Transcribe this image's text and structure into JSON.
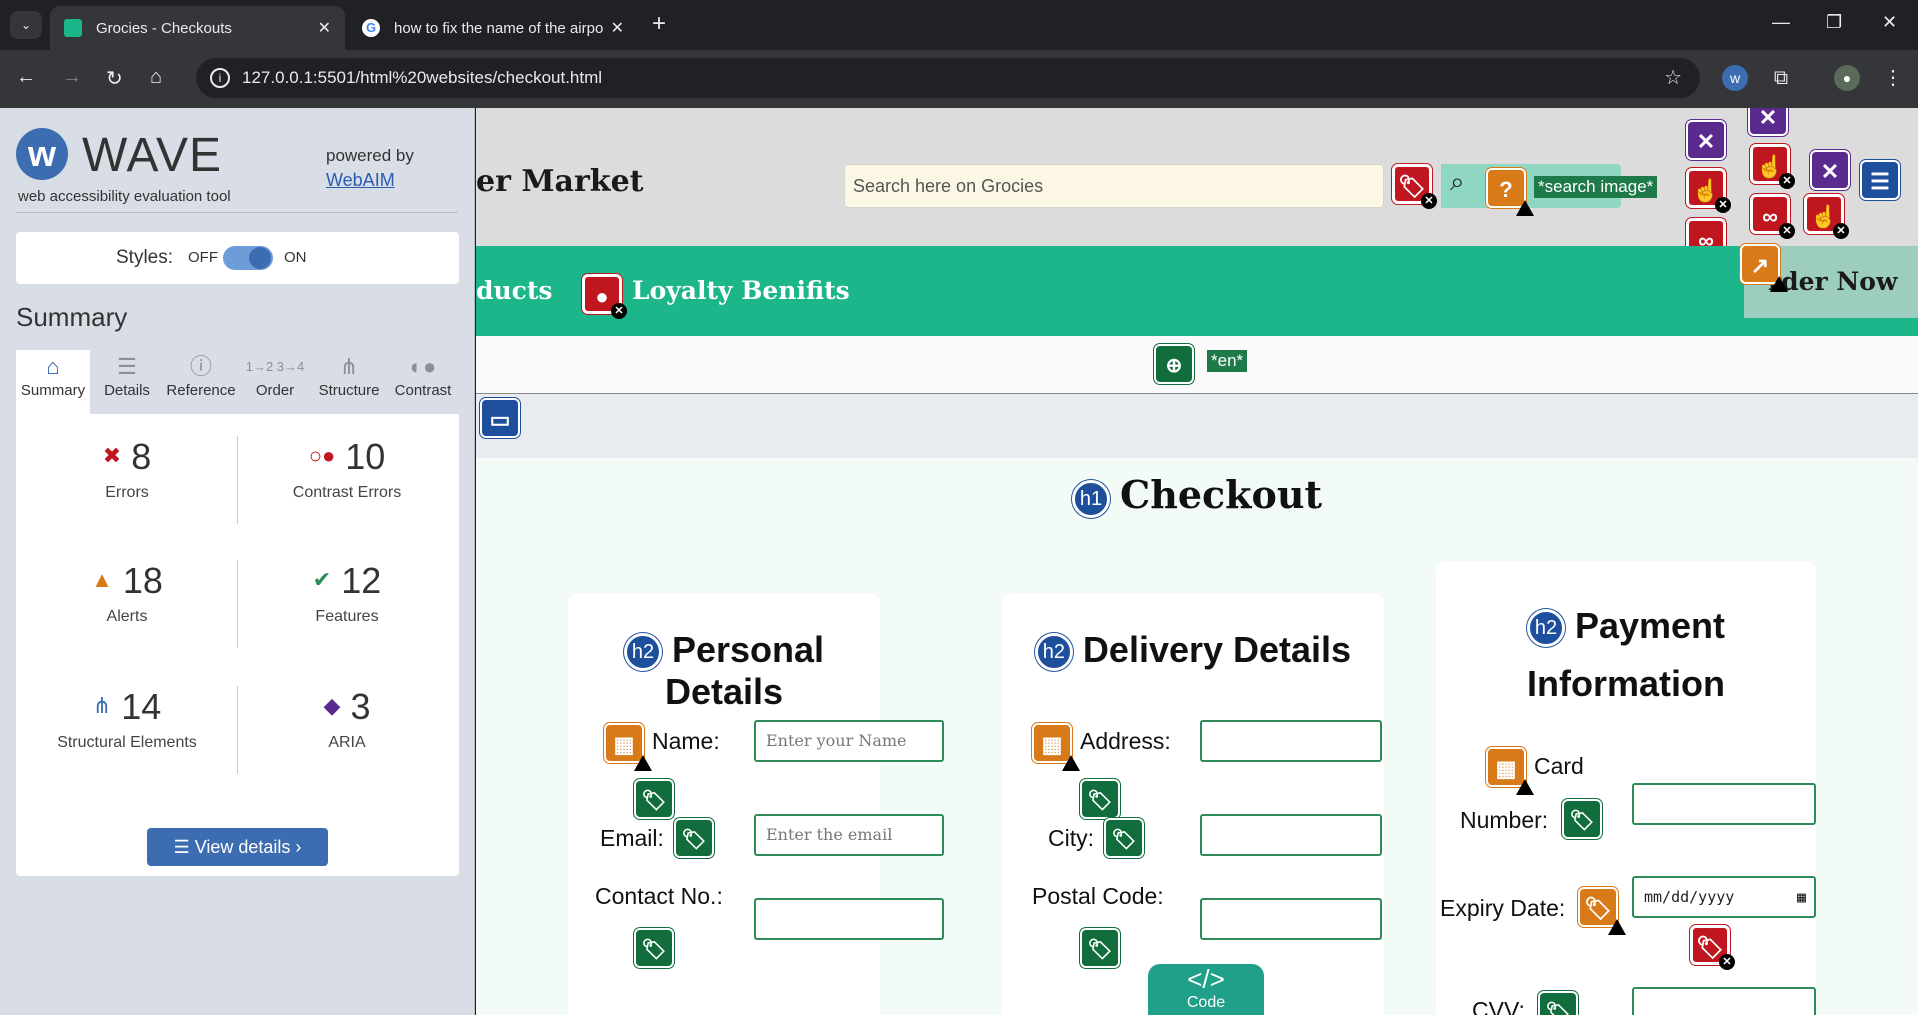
{
  "browser": {
    "tabs": [
      {
        "title": "Grocies - Checkouts",
        "active": true
      },
      {
        "title": "how to fix the name of the airpo",
        "active": false
      }
    ],
    "url": "127.0.0.1:5501/html%20websites/checkout.html"
  },
  "wave": {
    "name": "WAVE",
    "subtitle": "web accessibility evaluation tool",
    "powered_by": "powered by",
    "webaim": "WebAIM",
    "styles_label": "Styles:",
    "styles_off": "OFF",
    "styles_on": "ON",
    "summary_title": "Summary",
    "tabs": [
      "Summary",
      "Details",
      "Reference",
      "Order",
      "Structure",
      "Contrast"
    ],
    "stats": {
      "errors": {
        "count": "8",
        "label": "Errors"
      },
      "contrast": {
        "count": "10",
        "label": "Contrast Errors"
      },
      "alerts": {
        "count": "18",
        "label": "Alerts"
      },
      "features": {
        "count": "12",
        "label": "Features"
      },
      "structure": {
        "count": "14",
        "label": "Structural Elements"
      },
      "aria": {
        "count": "3",
        "label": "ARIA"
      }
    },
    "view_details": "View details ›"
  },
  "site": {
    "brand_partial": "er Market",
    "search_placeholder": "Search here on Grocies",
    "search_image_alt": "*search image*",
    "nav": [
      "ducts",
      "Loyalty Benifits"
    ],
    "order_now": "rder Now",
    "lang": "*en*",
    "page_title": "Checkout",
    "code_tab": "Code",
    "personal": {
      "title": "Personal Details",
      "name_label": "Name:",
      "name_placeholder": "Enter your Name",
      "email_label": "Email:",
      "email_placeholder": "Enter the email",
      "contact_label": "Contact No.:"
    },
    "delivery": {
      "title": "Delivery Details",
      "address_label": "Address:",
      "city_label": "City:",
      "postal_label": "Postal Code:"
    },
    "payment": {
      "title_line1": "Payment",
      "title_line2": "Information",
      "card_label_1": "Card",
      "card_label_2": "Number:",
      "expiry_label": "Expiry Date:",
      "expiry_placeholder": "mm/dd/yyyy",
      "cvv_label": "CVV:"
    }
  },
  "colors": {
    "accent": "#1db58a",
    "wave_blue": "#3d6db1",
    "error_red": "#c0161f",
    "feature_green": "#116d3c",
    "alert_orange": "#d97a18"
  }
}
